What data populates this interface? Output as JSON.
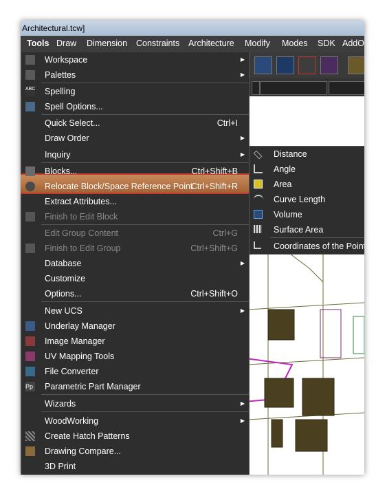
{
  "window_title": "Architectural.tcw]",
  "menubar": [
    "Tools",
    "Draw",
    "Dimension",
    "Constraints",
    "Architecture",
    "Modify",
    "Modes",
    "SDK",
    "AddO"
  ],
  "tools_menu": [
    {
      "label": "Workspace",
      "arrow": true,
      "icon": "workspace-icon"
    },
    {
      "label": "Palettes",
      "arrow": true,
      "icon": "palettes-icon"
    },
    {
      "label": "Spelling",
      "icon": "spelling-icon"
    },
    {
      "label": "Spell Options...",
      "icon": "spell-options-icon"
    },
    {
      "label": "Quick Select...",
      "shortcut": "Ctrl+I"
    },
    {
      "label": "Draw Order",
      "arrow": true
    },
    {
      "label": "Inquiry",
      "arrow": true,
      "highlight": true
    },
    {
      "label": "Blocks...",
      "shortcut": "Ctrl+Shift+B",
      "icon": "blocks-icon"
    },
    {
      "label": "Relocate Block/Space Reference Point",
      "shortcut": "Ctrl+Shift+R",
      "icon": "relocate-icon"
    },
    {
      "label": "Extract Attributes..."
    },
    {
      "label": "Finish to Edit Block",
      "disabled": true,
      "icon": "finish-block-icon"
    },
    {
      "label": "Edit Group Content",
      "shortcut": "Ctrl+G",
      "disabled": true
    },
    {
      "label": "Finish to Edit Group",
      "shortcut": "Ctrl+Shift+G",
      "disabled": true,
      "icon": "finish-group-icon"
    },
    {
      "label": "Database",
      "arrow": true
    },
    {
      "label": "Customize"
    },
    {
      "label": "Options...",
      "shortcut": "Ctrl+Shift+O"
    },
    {
      "label": "New UCS",
      "arrow": true
    },
    {
      "label": "Underlay Manager",
      "icon": "underlay-icon"
    },
    {
      "label": "Image Manager",
      "icon": "image-manager-icon"
    },
    {
      "label": "UV Mapping Tools",
      "icon": "uv-mapping-icon"
    },
    {
      "label": "File Converter",
      "icon": "file-converter-icon"
    },
    {
      "label": "Parametric Part Manager",
      "icon": "parametric-icon"
    },
    {
      "label": "Wizards",
      "arrow": true
    },
    {
      "label": "WoodWorking",
      "arrow": true
    },
    {
      "label": "Create Hatch Patterns",
      "icon": "hatch-icon"
    },
    {
      "label": "Drawing Compare...",
      "icon": "compare-icon"
    },
    {
      "label": "3D Print"
    }
  ],
  "inquiry_submenu": [
    {
      "label": "Distance",
      "icon": "distance-icon"
    },
    {
      "label": "Angle",
      "icon": "angle-icon"
    },
    {
      "label": "Area",
      "icon": "area-icon"
    },
    {
      "label": "Curve Length",
      "icon": "curve-length-icon"
    },
    {
      "label": "Volume",
      "icon": "volume-icon"
    },
    {
      "label": "Surface Area",
      "icon": "surface-area-icon"
    },
    {
      "label": "Coordinates of the Point",
      "icon": "coordinates-icon"
    }
  ],
  "colors": {
    "highlight_border": "#c0392b",
    "highlight_fill": "#b8723f",
    "menu_bg": "#2e2e2e",
    "disabled_text": "#8a8a8a"
  }
}
